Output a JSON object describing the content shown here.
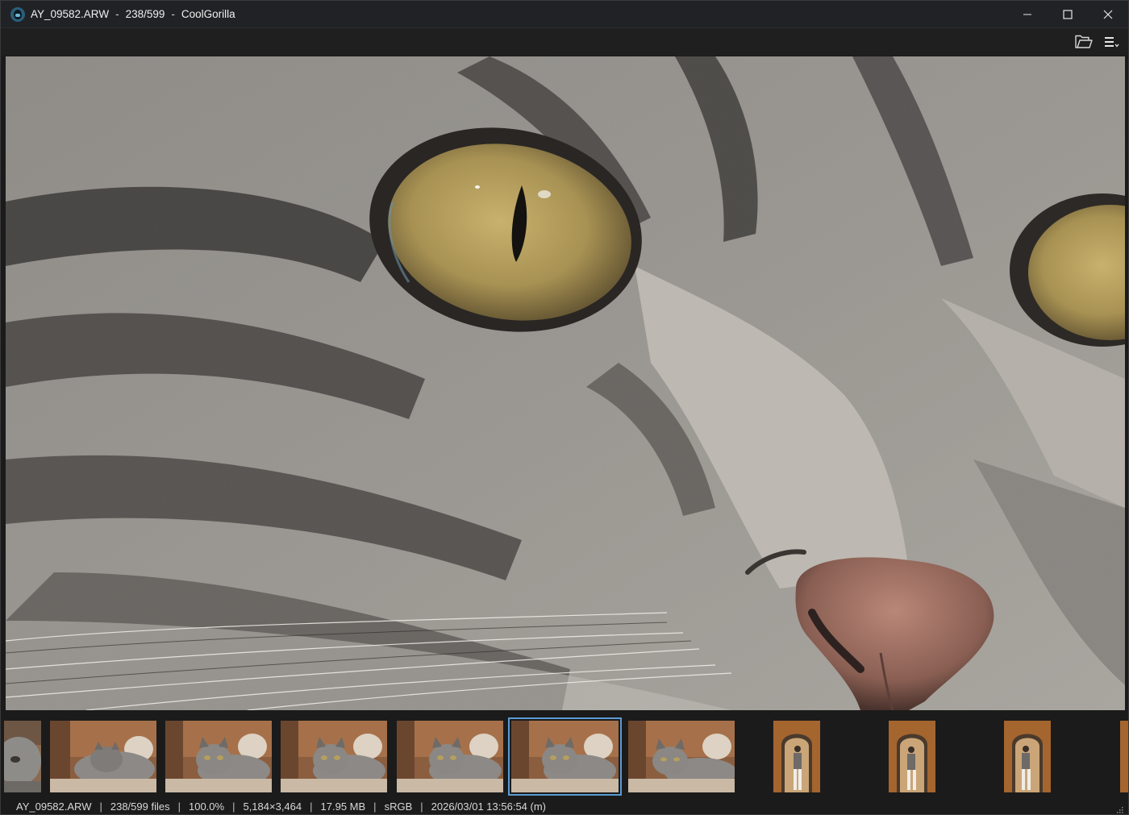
{
  "window": {
    "filename": "AY_09582.ARW",
    "position": "238/599",
    "separator": "-",
    "app_name": "CoolGorilla"
  },
  "toolbar": {
    "open_folder_icon": "folder-open-icon",
    "menu_icon": "hamburger-menu-icon"
  },
  "viewer": {
    "image_description": "cat-closeup-eye-nose"
  },
  "filmstrip": {
    "selected_index": 5,
    "thumbnails": [
      "cat-partial",
      "cat-lying",
      "cat-sitting",
      "cat-sitting",
      "cat-sitting",
      "cat-sitting",
      "cat-lying-2",
      "person-doorway",
      "person-doorway",
      "person-doorway"
    ]
  },
  "status": {
    "filename": "AY_09582.ARW",
    "files": "238/599 files",
    "zoom": "100.0%",
    "dimensions": "5,184×3,464",
    "size": "17.95 MB",
    "color_space": "sRGB",
    "date": "2026/03/01 13:56:54 (m)",
    "separator": "|"
  },
  "colors": {
    "accent": "#5b9bd5",
    "titlebar": "#202225",
    "background": "#1b1b1b"
  }
}
